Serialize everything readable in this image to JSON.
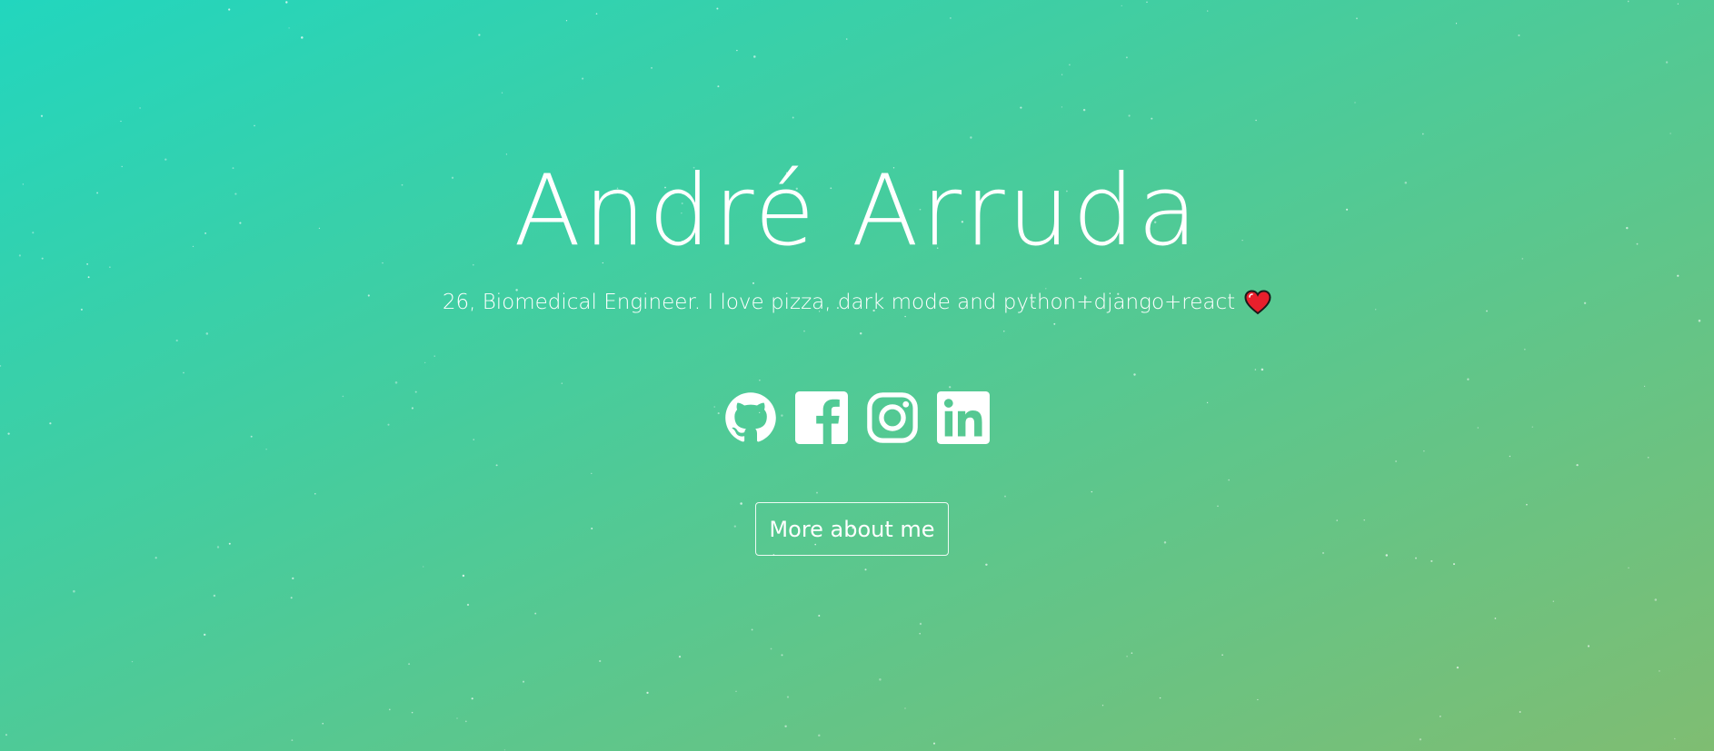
{
  "hero": {
    "name": "André Arruda",
    "tagline": "26, Biomedical Engineer. I love pizza, dark mode and python+django+react",
    "tagline_icon": "heart-icon",
    "heart_color": "#e8202c",
    "button_label": "More about me"
  },
  "socials": [
    {
      "name": "github",
      "icon": "github-icon"
    },
    {
      "name": "facebook",
      "icon": "facebook-icon"
    },
    {
      "name": "instagram",
      "icon": "instagram-icon"
    },
    {
      "name": "linkedin",
      "icon": "linkedin-icon"
    }
  ],
  "colors": {
    "gradient_start": "#22d6be",
    "gradient_end": "#7fbd72",
    "text": "#ffffff"
  }
}
